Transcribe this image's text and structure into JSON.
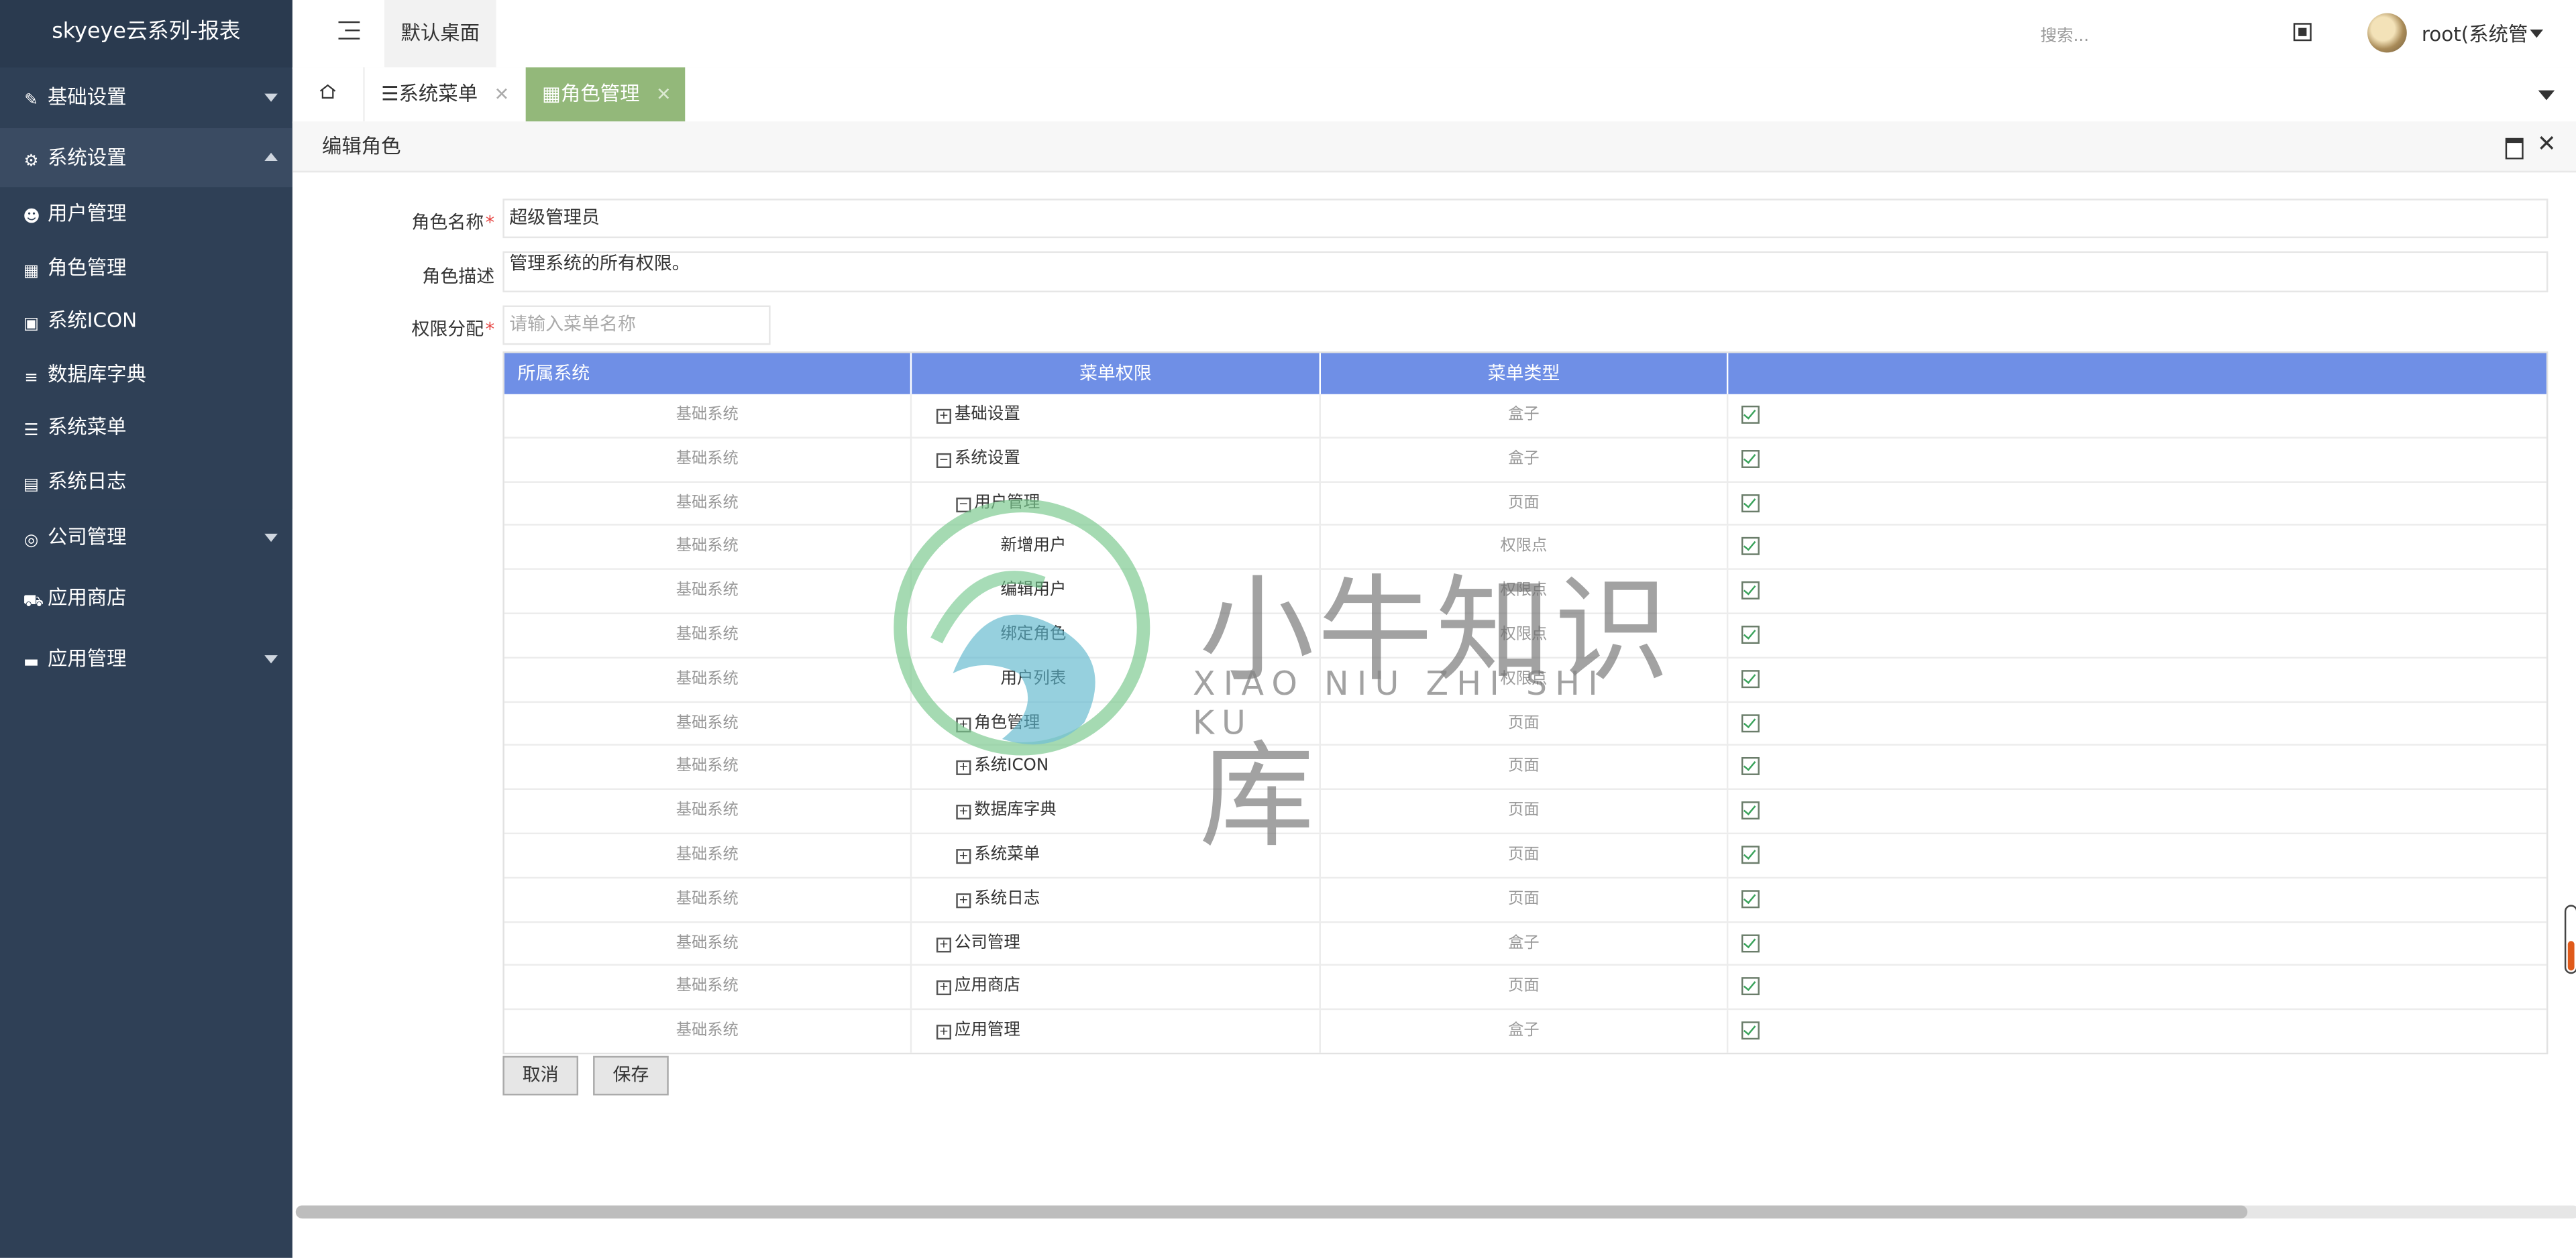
{
  "brand": "skyeye云系列-报表",
  "sidebar": {
    "groups": [
      {
        "label": "基础设置",
        "icon": "edit-icon",
        "state": "collapsed"
      },
      {
        "label": "系统设置",
        "icon": "gear-icon",
        "state": "expanded"
      },
      {
        "label": "公司管理",
        "icon": "company-icon",
        "state": "collapsed"
      },
      {
        "label": "应用商店",
        "icon": "cart-icon",
        "state": "none"
      },
      {
        "label": "应用管理",
        "icon": "archive-icon",
        "state": "collapsed"
      }
    ],
    "sub_items": [
      {
        "label": "用户管理",
        "icon": "users-icon"
      },
      {
        "label": "角色管理",
        "icon": "grid-icon"
      },
      {
        "label": "系统ICON",
        "icon": "image-icon"
      },
      {
        "label": "数据库字典",
        "icon": "database-icon"
      },
      {
        "label": "系统菜单",
        "icon": "list-icon"
      },
      {
        "label": "系统日志",
        "icon": "log-icon"
      }
    ]
  },
  "topbar": {
    "desk_tab": "默认桌面",
    "search_placeholder": "搜索...",
    "user_name": "root(系统管理员)"
  },
  "tabs": [
    {
      "label": "系统菜单",
      "icon": "list-icon",
      "active": false
    },
    {
      "label": "角色管理",
      "icon": "grid-icon",
      "active": true
    }
  ],
  "panel": {
    "title": "编辑角色"
  },
  "form": {
    "role_name_label": "角色名称",
    "role_name_value": "超级管理员",
    "role_desc_label": "角色描述",
    "role_desc_value": "管理系统的所有权限。",
    "perm_label": "权限分配",
    "perm_search_placeholder": "请输入菜单名称",
    "required_mark": "*"
  },
  "table": {
    "headers": [
      "所属系统",
      "菜单权限",
      "菜单类型",
      ""
    ],
    "rows": [
      {
        "system": "基础系统",
        "menu": "基础设置",
        "level": 0,
        "tree": "plus",
        "type": "盒子",
        "checked": true
      },
      {
        "system": "基础系统",
        "menu": "系统设置",
        "level": 0,
        "tree": "minus",
        "type": "盒子",
        "checked": true
      },
      {
        "system": "基础系统",
        "menu": "用户管理",
        "level": 1,
        "tree": "minus",
        "type": "页面",
        "checked": true
      },
      {
        "system": "基础系统",
        "menu": "新增用户",
        "level": 2,
        "tree": "none",
        "type": "权限点",
        "checked": true
      },
      {
        "system": "基础系统",
        "menu": "编辑用户",
        "level": 2,
        "tree": "none",
        "type": "权限点",
        "checked": true
      },
      {
        "system": "基础系统",
        "menu": "绑定角色",
        "level": 2,
        "tree": "none",
        "type": "权限点",
        "checked": true
      },
      {
        "system": "基础系统",
        "menu": "用户列表",
        "level": 2,
        "tree": "none",
        "type": "权限点",
        "checked": true
      },
      {
        "system": "基础系统",
        "menu": "角色管理",
        "level": 1,
        "tree": "plus",
        "type": "页面",
        "checked": true
      },
      {
        "system": "基础系统",
        "menu": "系统ICON",
        "level": 1,
        "tree": "plus",
        "type": "页面",
        "checked": true
      },
      {
        "system": "基础系统",
        "menu": "数据库字典",
        "level": 1,
        "tree": "plus",
        "type": "页面",
        "checked": true
      },
      {
        "system": "基础系统",
        "menu": "系统菜单",
        "level": 1,
        "tree": "plus",
        "type": "页面",
        "checked": true
      },
      {
        "system": "基础系统",
        "menu": "系统日志",
        "level": 1,
        "tree": "plus",
        "type": "页面",
        "checked": true
      },
      {
        "system": "基础系统",
        "menu": "公司管理",
        "level": 0,
        "tree": "plus",
        "type": "盒子",
        "checked": true
      },
      {
        "system": "基础系统",
        "menu": "应用商店",
        "level": 0,
        "tree": "plus",
        "type": "页面",
        "checked": true
      },
      {
        "system": "基础系统",
        "menu": "应用管理",
        "level": 0,
        "tree": "plus",
        "type": "盒子",
        "checked": true
      }
    ]
  },
  "buttons": {
    "cancel": "取消",
    "save": "保存"
  },
  "watermark": {
    "cn": "小牛知识库",
    "en": "XIAO NIU ZHI SHI KU"
  },
  "scroll": {
    "horizontal_fraction": 0.855
  },
  "colors": {
    "sidebar_bg": "#2f4056",
    "header_blue": "#6f8fe6",
    "active_tab": "#93b87a",
    "check_green": "#3aa35b"
  }
}
